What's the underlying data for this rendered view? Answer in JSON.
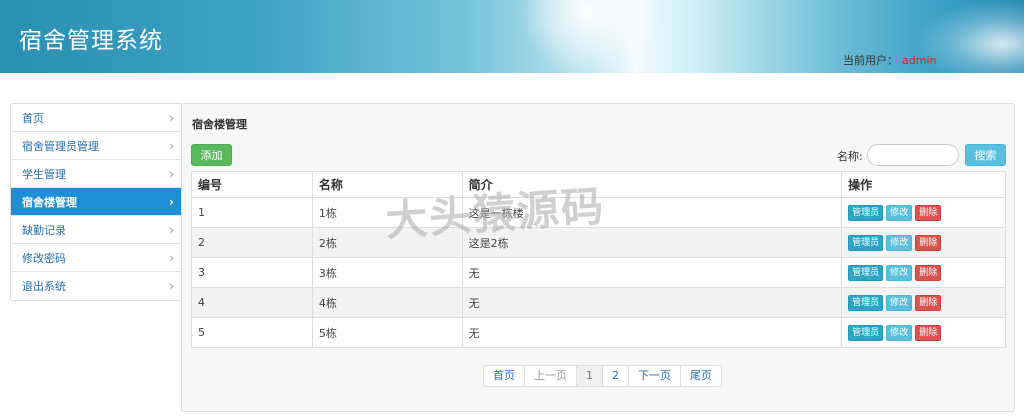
{
  "header": {
    "title": "宿舍管理系统",
    "current_user_label": "当前用户：",
    "current_user": "admin"
  },
  "sidebar": {
    "items": [
      {
        "label": "首页",
        "active": false
      },
      {
        "label": "宿舍管理员管理",
        "active": false
      },
      {
        "label": "学生管理",
        "active": false
      },
      {
        "label": "宿舍楼管理",
        "active": true
      },
      {
        "label": "缺勤记录",
        "active": false
      },
      {
        "label": "修改密码",
        "active": false
      },
      {
        "label": "退出系统",
        "active": false
      }
    ]
  },
  "main": {
    "title": "宿舍楼管理",
    "add_label": "添加",
    "search_label": "名称:",
    "search_value": "",
    "search_button": "搜索",
    "columns": [
      "编号",
      "名称",
      "简介",
      "操作"
    ],
    "rows": [
      {
        "id": "1",
        "name": "1栋",
        "desc": "这是一栋楼"
      },
      {
        "id": "2",
        "name": "2栋",
        "desc": "这是2栋"
      },
      {
        "id": "3",
        "name": "3栋",
        "desc": "无"
      },
      {
        "id": "4",
        "name": "4栋",
        "desc": "无"
      },
      {
        "id": "5",
        "name": "5栋",
        "desc": "无"
      }
    ],
    "row_actions": {
      "manager": "管理员",
      "edit": "修改",
      "delete": "删除"
    }
  },
  "pagination": {
    "first": "首页",
    "prev": "上一页",
    "pages": [
      "1",
      "2"
    ],
    "current": "1",
    "next": "下一页",
    "last": "尾页"
  },
  "watermark": "大头猿源码",
  "colors": {
    "active_nav": "#1e8fd6",
    "add_button": "#5cb85c",
    "search_button": "#5bc0de",
    "delete_button": "#d9534f",
    "user_name": "#e02020"
  }
}
